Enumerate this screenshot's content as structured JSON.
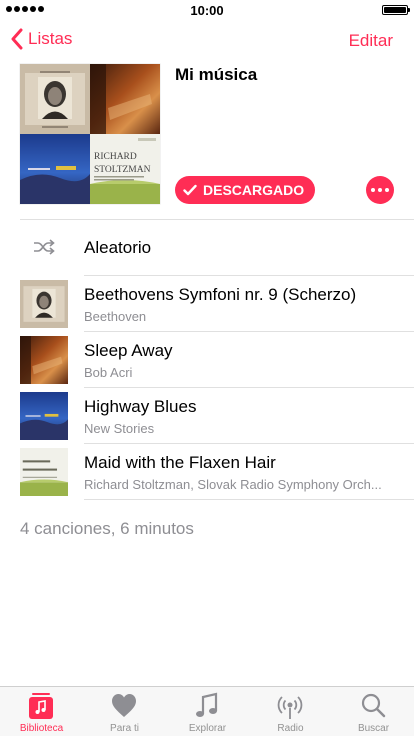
{
  "status_bar": {
    "time": "10:00"
  },
  "nav": {
    "back_label": "Listas",
    "edit_label": "Editar"
  },
  "colors": {
    "accent": "#ff2d55",
    "secondary_text": "#8e8e93"
  },
  "header": {
    "title": "Mi música",
    "downloaded_label": "DESCARGADO",
    "artwork_text": {
      "richard": "RICHARD",
      "stoltzman": "STOLTZMAN"
    }
  },
  "shuffle": {
    "label": "Aleatorio",
    "icon": "shuffle-icon"
  },
  "songs": [
    {
      "title": "Beethovens Symfoni nr. 9 (Scherzo)",
      "artist": "Beethoven"
    },
    {
      "title": "Sleep Away",
      "artist": "Bob Acri"
    },
    {
      "title": "Highway Blues",
      "artist": "New Stories"
    },
    {
      "title": "Maid with the Flaxen Hair",
      "artist": "Richard Stoltzman, Slovak Radio Symphony Orch..."
    }
  ],
  "summary": "4 canciones, 6 minutos",
  "tabs": [
    {
      "label": "Biblioteca",
      "icon": "library-icon",
      "active": true
    },
    {
      "label": "Para ti",
      "icon": "heart-icon",
      "active": false
    },
    {
      "label": "Explorar",
      "icon": "music-note-icon",
      "active": false
    },
    {
      "label": "Radio",
      "icon": "radio-icon",
      "active": false
    },
    {
      "label": "Buscar",
      "icon": "search-icon",
      "active": false
    }
  ]
}
